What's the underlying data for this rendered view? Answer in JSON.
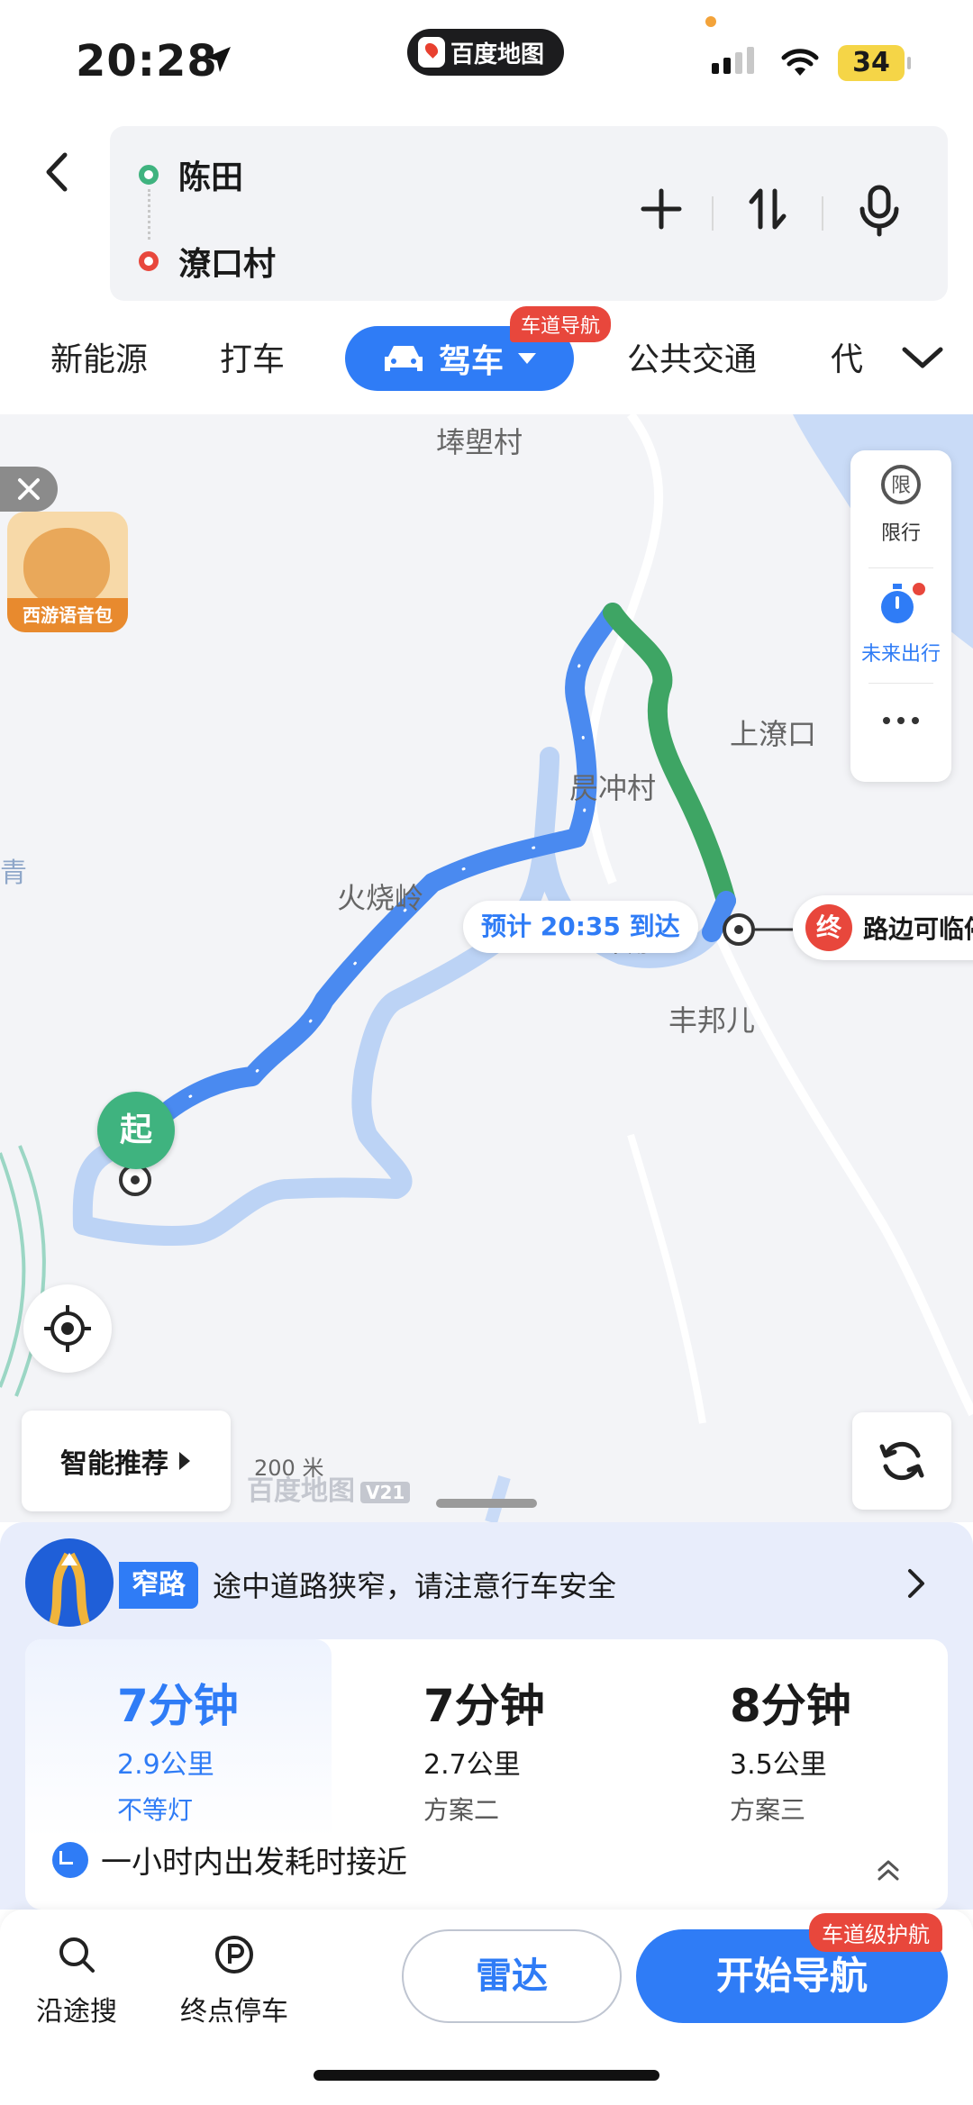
{
  "status_bar": {
    "time": "20:28",
    "app_name": "百度地图",
    "battery": "34"
  },
  "route": {
    "start": "陈田",
    "end": "潦口村"
  },
  "tabs": {
    "new_energy": "新能源",
    "taxi": "打车",
    "drive": "驾车",
    "drive_badge": "车道导航",
    "transit": "公共交通",
    "more": "代"
  },
  "map": {
    "places": [
      "埲塱村",
      "上潦口",
      "昃冲村",
      "火烧岭",
      "山嘴",
      "丰邦儿",
      "青"
    ],
    "voice_pack": "西游语音包",
    "restriction": "限行",
    "restriction_glyph": "限",
    "future_trip": "未来出行",
    "eta_label": "预计 20:35 到达",
    "dest_marker": "终",
    "dest_label": "路边可临停",
    "start_marker": "起",
    "smart_recommend": "智能推荐",
    "scale": "200 米",
    "watermark": "百度地图",
    "watermark_version": "V21",
    "colors": {
      "primary_route": "#4a8af0",
      "alt_route": "#bcd3f5",
      "final_segment": "#3ea564",
      "water": "#c9dbf7"
    }
  },
  "sheet": {
    "warn_tag": "窄路",
    "warn_text": "途中道路狭窄，请注意行车安全",
    "routes": [
      {
        "time": "7分钟",
        "distance": "2.9公里",
        "tag": "不等灯",
        "selected": true
      },
      {
        "time": "7分钟",
        "distance": "2.7公里",
        "tag": "方案二",
        "selected": false
      },
      {
        "time": "8分钟",
        "distance": "3.5公里",
        "tag": "方案三",
        "selected": false
      }
    ],
    "hour_note": "一小时内出发耗时接近"
  },
  "action_bar": {
    "search_along": "沿途搜",
    "parking": "终点停车",
    "radar": "雷达",
    "start_nav": "开始导航",
    "nav_badge": "车道级护航"
  }
}
